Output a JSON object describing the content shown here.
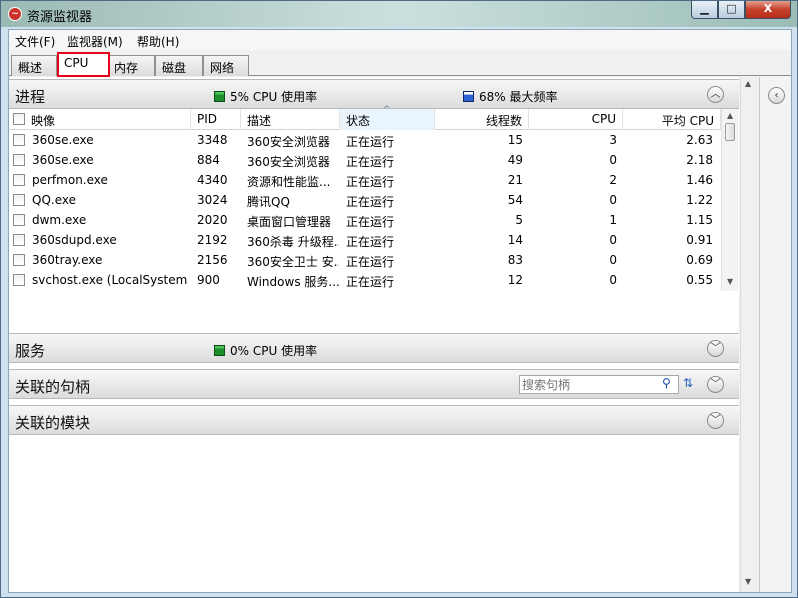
{
  "window": {
    "title": "资源监视器",
    "min": "▁",
    "max": "□",
    "close": "X"
  },
  "menu": [
    "文件(F)",
    "监视器(M)",
    "帮助(H)"
  ],
  "tabs": [
    "概述",
    "CPU",
    "内存",
    "磁盘",
    "网络"
  ],
  "processes": {
    "title": "进程",
    "cpu_usage": "5% CPU 使用率",
    "max_freq": "68% 最大频率",
    "columns": [
      "映像",
      "PID",
      "描述",
      "状态",
      "线程数",
      "CPU",
      "平均 CPU"
    ],
    "rows": [
      [
        "360se.exe",
        "3348",
        "360安全浏览器",
        "正在运行",
        "15",
        "3",
        "2.63"
      ],
      [
        "360se.exe",
        "884",
        "360安全浏览器",
        "正在运行",
        "49",
        "0",
        "2.18"
      ],
      [
        "perfmon.exe",
        "4340",
        "资源和性能监...",
        "正在运行",
        "21",
        "2",
        "1.46"
      ],
      [
        "QQ.exe",
        "3024",
        "腾讯QQ",
        "正在运行",
        "54",
        "0",
        "1.22"
      ],
      [
        "dwm.exe",
        "2020",
        "桌面窗口管理器",
        "正在运行",
        "5",
        "1",
        "1.15"
      ],
      [
        "360sdupd.exe",
        "2192",
        "360杀毒 升级程...",
        "正在运行",
        "14",
        "0",
        "0.91"
      ],
      [
        "360tray.exe",
        "2156",
        "360安全卫士 安...",
        "正在运行",
        "83",
        "0",
        "0.69"
      ],
      [
        "svchost.exe (LocalSystemN...",
        "900",
        "Windows 服务...",
        "正在运行",
        "12",
        "0",
        "0.55"
      ]
    ]
  },
  "services": {
    "title": "服务",
    "cpu_usage": "0% CPU 使用率"
  },
  "handles": {
    "title": "关联的句柄",
    "search_placeholder": "搜索句柄"
  },
  "modules": {
    "title": "关联的模块"
  },
  "colors": {
    "highlight": "#e8001c",
    "cpu_green": "#1e8d2c",
    "freq_blue": "#2454b8"
  }
}
